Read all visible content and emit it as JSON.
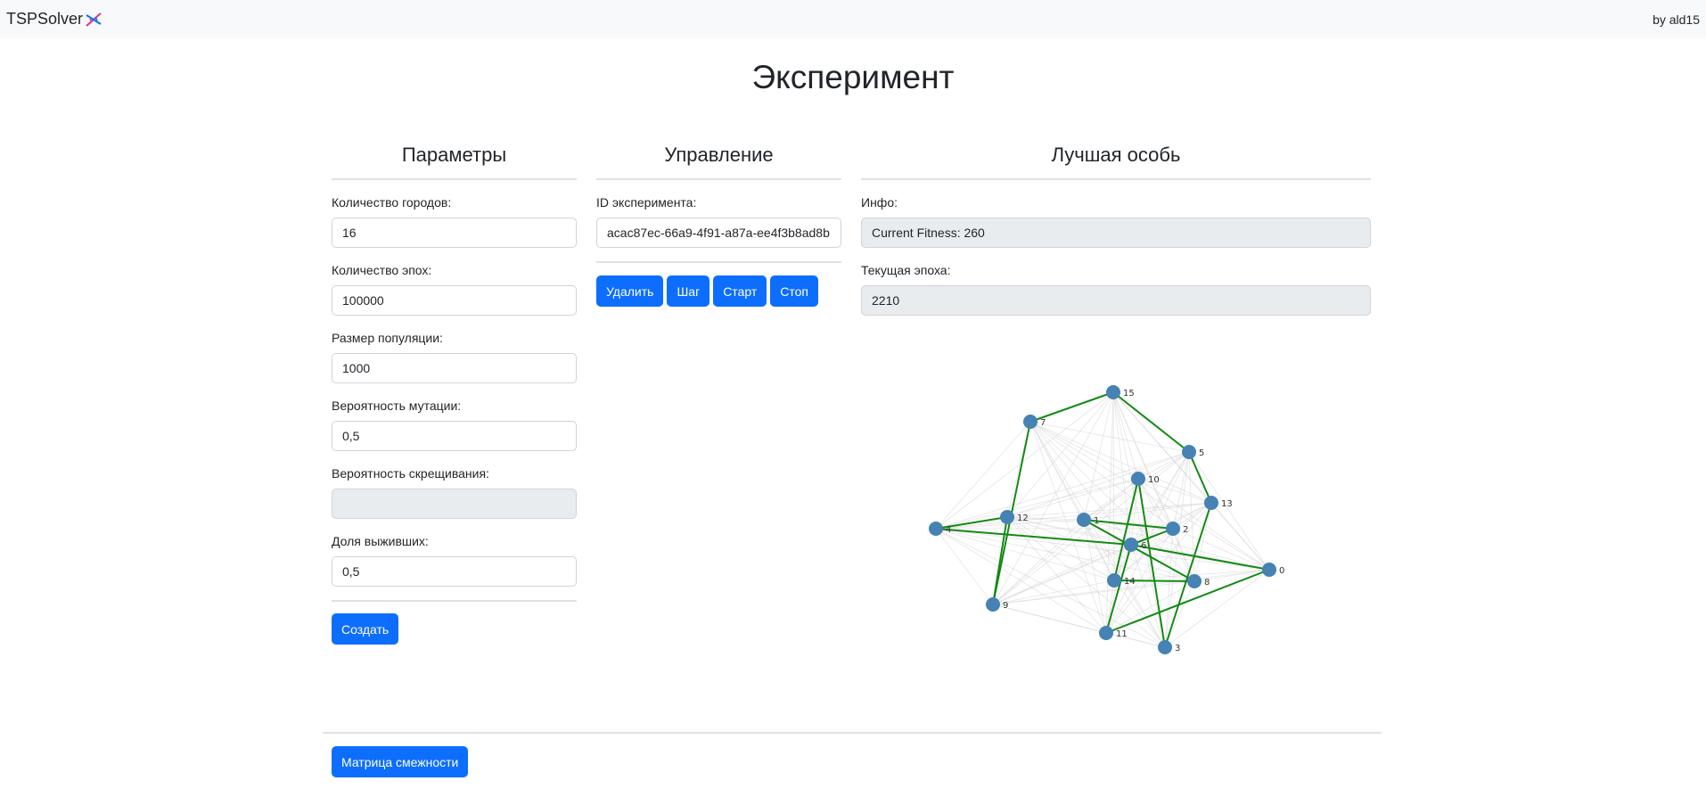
{
  "navbar": {
    "brand": "TSPSolver",
    "author": "by ald15"
  },
  "page": {
    "title": "Эксперимент"
  },
  "params": {
    "heading": "Параметры",
    "fields": [
      {
        "label": "Количество городов:",
        "value": "16"
      },
      {
        "label": "Количество эпох:",
        "value": "100000"
      },
      {
        "label": "Размер популяции:",
        "value": "1000"
      },
      {
        "label": "Вероятность мутации:",
        "value": "0,5"
      },
      {
        "label": "Вероятность скрещивания:",
        "value": ""
      },
      {
        "label": "Доля выживших:",
        "value": "0,5"
      }
    ],
    "create_label": "Создать"
  },
  "control": {
    "heading": "Управление",
    "id_label": "ID эксперимента:",
    "id_value": "acac87ec-66a9-4f91-a87a-ee4f3b8ad8b",
    "buttons": {
      "delete": "Удалить",
      "step": "Шаг",
      "start": "Старт",
      "stop": "Стоп"
    }
  },
  "best": {
    "heading": "Лучшая особь",
    "info_label": "Инфо:",
    "info_value": "Current Fitness: 260",
    "epoch_label": "Текущая эпоха:",
    "epoch_value": "2210"
  },
  "graph": {
    "node_color": "#4682b4",
    "route_color": "#138a13",
    "edge_color": "#d3d3d3",
    "nodes": [
      "0",
      "1",
      "2",
      "3",
      "4",
      "5",
      "6",
      "7",
      "8",
      "9",
      "10",
      "11",
      "12",
      "13",
      "14",
      "15"
    ]
  },
  "footer": {
    "matrix_label": "Матрица смежности"
  }
}
